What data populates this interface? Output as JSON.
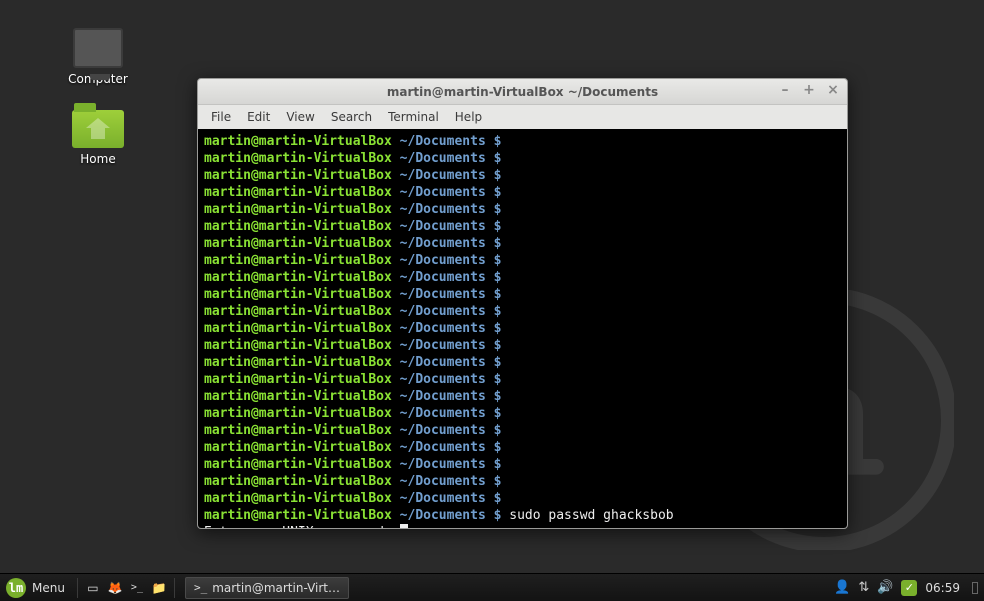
{
  "desktop": {
    "icons": [
      {
        "name": "computer",
        "label": "Computer"
      },
      {
        "name": "home",
        "label": "Home"
      }
    ]
  },
  "window": {
    "title": "martin@martin-VirtualBox ~/Documents",
    "menu": [
      "File",
      "Edit",
      "View",
      "Search",
      "Terminal",
      "Help"
    ],
    "controls": {
      "minimize": "–",
      "maximize": "+",
      "close": "×"
    }
  },
  "terminal": {
    "prompt_user": "martin@martin-VirtualBox",
    "prompt_path": "~/Documents",
    "prompt_sigil": "$",
    "empty_prompt_count": 22,
    "command": "sudo passwd ghacksbob",
    "output_line": "Enter new UNIX password: "
  },
  "taskbar": {
    "menu_label": "Menu",
    "launchers": [
      {
        "name": "show-desktop-icon",
        "glyph": "▭"
      },
      {
        "name": "firefox-icon",
        "glyph": "🦊"
      },
      {
        "name": "terminal-icon",
        "glyph": ">_"
      },
      {
        "name": "files-icon",
        "glyph": "📁"
      }
    ],
    "task": {
      "icon": ">_",
      "label": "martin@martin-Virt…"
    },
    "tray": {
      "user_icon": "👤",
      "wifi_icon": "⇅",
      "volume_icon": "🔊",
      "shield_icon": "✓",
      "clock": "06:59"
    }
  },
  "colors": {
    "accent": "#7ab02c",
    "term_green": "#8ae234",
    "term_blue": "#729fcf"
  }
}
